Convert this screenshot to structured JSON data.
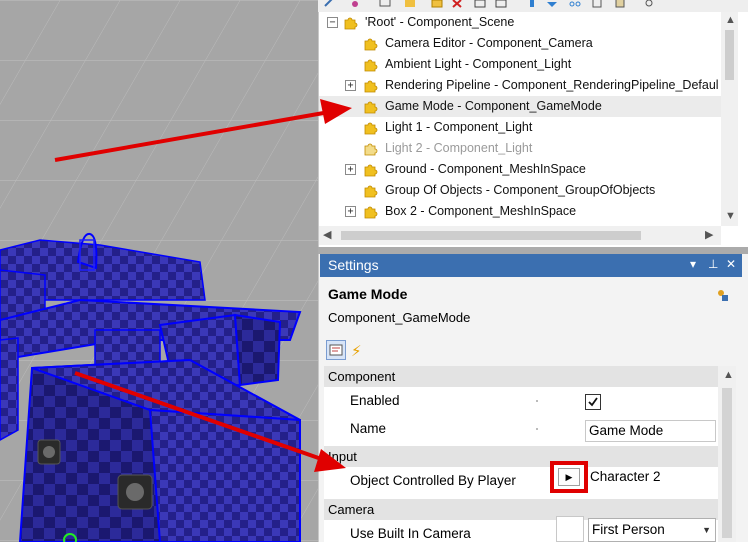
{
  "tree": {
    "rows": [
      {
        "label": "'Root' - Component_Scene",
        "expander": "−",
        "disabled": false,
        "selected": false
      },
      {
        "label": "Camera Editor - Component_Camera",
        "expander": "",
        "disabled": false,
        "selected": false
      },
      {
        "label": "Ambient Light - Component_Light",
        "expander": "",
        "disabled": false,
        "selected": false
      },
      {
        "label": "Rendering Pipeline - Component_RenderingPipeline_Defaul",
        "expander": "+",
        "disabled": false,
        "selected": false
      },
      {
        "label": "Game Mode - Component_GameMode",
        "expander": "",
        "disabled": false,
        "selected": true
      },
      {
        "label": "Light 1 - Component_Light",
        "expander": "",
        "disabled": false,
        "selected": false
      },
      {
        "label": "Light 2 - Component_Light",
        "expander": "",
        "disabled": true,
        "selected": false
      },
      {
        "label": "Ground - Component_MeshInSpace",
        "expander": "+",
        "disabled": false,
        "selected": false
      },
      {
        "label": "Group Of Objects - Component_GroupOfObjects",
        "expander": "",
        "disabled": false,
        "selected": false
      },
      {
        "label": "Box 2 - Component_MeshInSpace",
        "expander": "+",
        "disabled": false,
        "selected": false
      }
    ]
  },
  "settings": {
    "title": "Settings",
    "header_buttons": [
      "▾",
      "⊥",
      "✕"
    ],
    "object_name": "Game Mode",
    "object_type": "Component_GameMode",
    "categories": {
      "component": "Component",
      "input": "Input",
      "camera": "Camera"
    },
    "props": {
      "enabled_label": "Enabled",
      "enabled_checked": true,
      "name_label": "Name",
      "name_value": "Game Mode",
      "ocp_label": "Object Controlled By Player",
      "ocp_button": "▶",
      "ocp_value": "Character 2",
      "camera_label": "Use Built In Camera",
      "camera_value": "First Person"
    }
  },
  "colors": {
    "accent": "#3b6fb0",
    "annotation_red": "#e00000",
    "selection": "#ebebeb"
  }
}
